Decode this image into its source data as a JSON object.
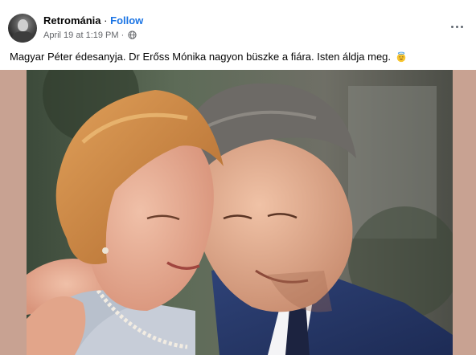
{
  "post": {
    "author": "Retrománia",
    "separator": "·",
    "follow_label": "Follow",
    "timestamp": "April 19 at 1:19 PM",
    "meta_separator": "·",
    "privacy_icon": "globe-icon",
    "more_icon": "more-options-icon",
    "caption": "Magyar Péter édesanyja. Dr Erőss Mónika nagyon büszke a fiára. Isten áldja meg.",
    "caption_emoji": "smiling-face-with-halo-emoji-icon",
    "photo_icon": "photo-of-mother-and-son-embracing"
  },
  "colors": {
    "link_blue": "#1b74e4",
    "secondary_text": "#65676b",
    "photo_border": "#c8a292"
  }
}
